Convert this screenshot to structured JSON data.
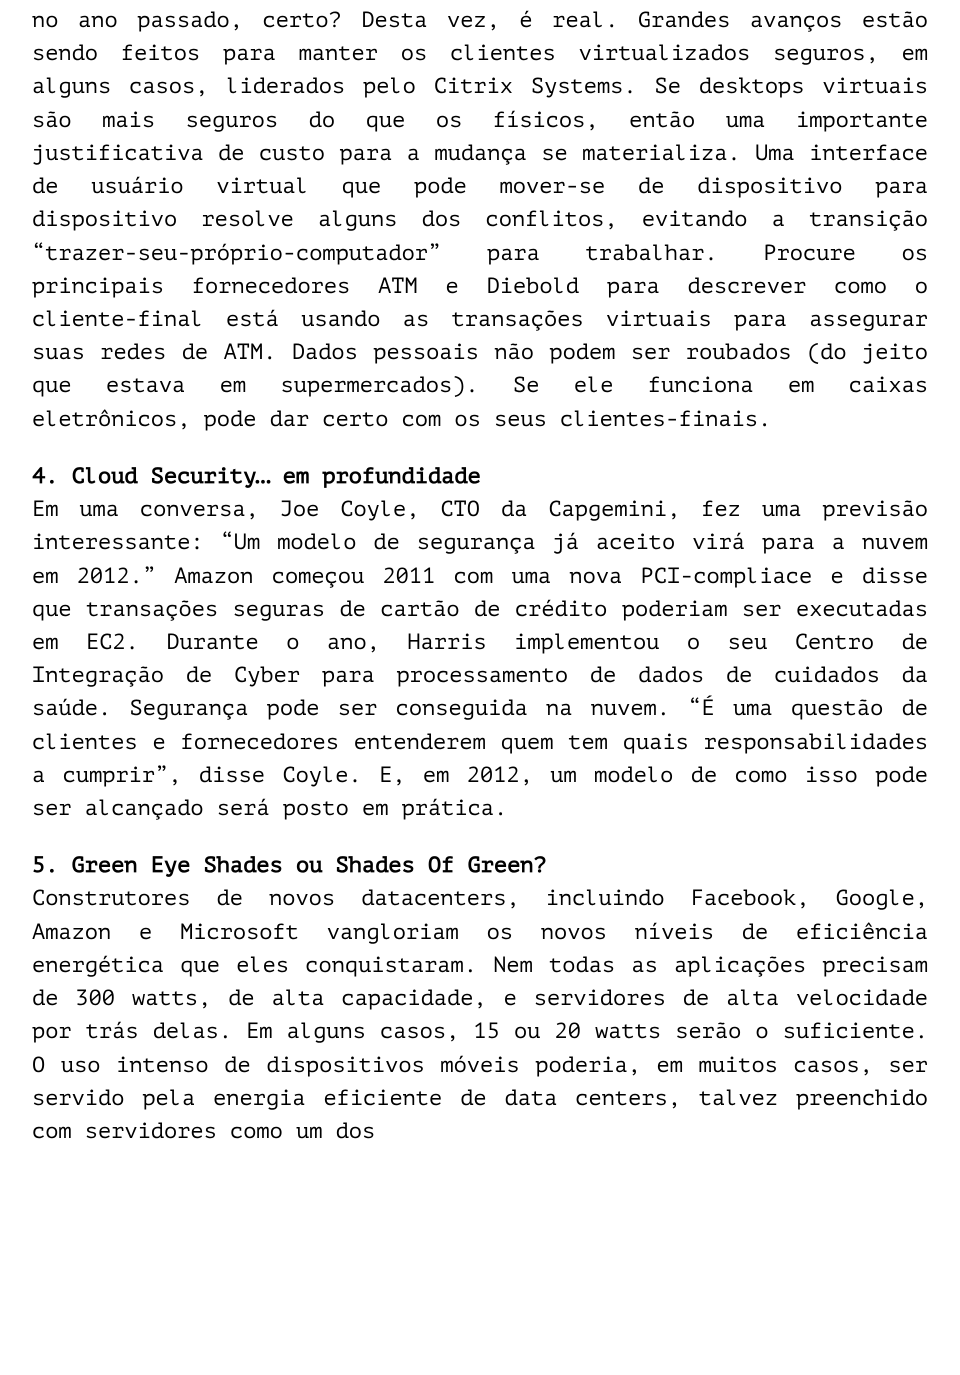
{
  "paragraphs": {
    "p1": "no ano passado, certo? Desta vez, é real. Grandes avanços estão sendo feitos para manter os clientes virtualizados seguros, em alguns casos, liderados pelo Citrix Systems. Se desktops virtuais são mais seguros do que os físicos, então uma importante justificativa de custo para a mudança se materializa. Uma interface de usuário virtual que pode mover-se de dispositivo para dispositivo resolve alguns dos conflitos, evitando a transição “trazer-seu-próprio-computador” para trabalhar. Procure os principais fornecedores ATM e Diebold para descrever como o cliente-final está usando as transações virtuais para assegurar suas redes de ATM. Dados pessoais não podem ser roubados (do jeito que estava em supermercados). Se ele funciona em caixas eletrônicos, pode dar certo com os seus clientes-finais.",
    "h4": "4. Cloud Security… em profundidade",
    "p4": "Em uma conversa, Joe Coyle, CTO da Capgemini, fez uma previsão interessante: “Um modelo de segurança já aceito virá para a nuvem em 2012.” Amazon começou 2011 com uma nova PCI-compliace e disse que transações seguras de cartão de crédito poderiam ser executadas em EC2. Durante o ano, Harris implementou o seu Centro de Integração de Cyber para processamento de dados de cuidados da saúde. Segurança pode ser conseguida na nuvem. “É uma questão de clientes e fornecedores entenderem quem tem quais responsabilidades a cumprir”, disse Coyle. E, em 2012, um modelo de como isso pode ser alcançado será posto em prática.",
    "h5": "5. Green Eye Shades ou Shades Of Green?",
    "p5": "Construtores de novos datacenters, incluindo Facebook, Google, Amazon e Microsoft vangloriam os novos níveis de eficiência energética que eles conquistaram. Nem todas as aplicações precisam de 300 watts, de alta capacidade, e servidores de alta velocidade por trás delas. Em alguns casos, 15 ou 20 watts serão o suficiente. O uso intenso de dispositivos móveis poderia, em muitos casos, ser servido pela energia eficiente de data centers, talvez preenchido com servidores como um dos"
  }
}
